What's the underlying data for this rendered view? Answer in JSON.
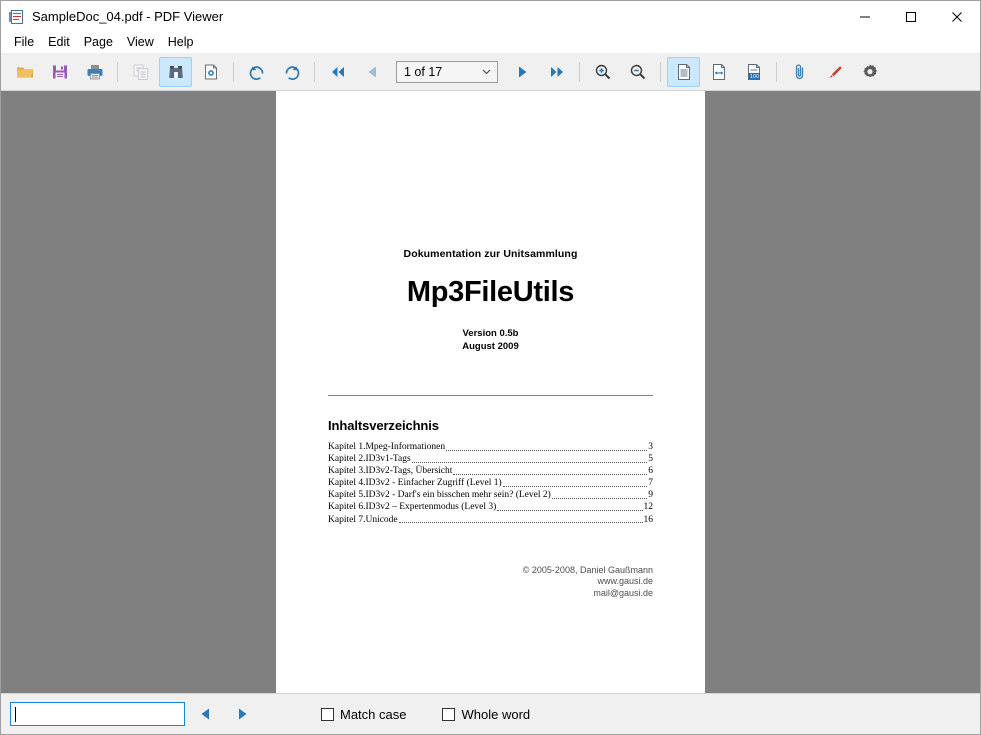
{
  "window": {
    "title": "SampleDoc_04.pdf - PDF Viewer",
    "app_icon": "pdf-document-icon",
    "controls": {
      "minimize": "minimize-icon",
      "maximize": "maximize-icon",
      "close": "close-icon"
    }
  },
  "menubar": {
    "items": [
      {
        "label": "File"
      },
      {
        "label": "Edit"
      },
      {
        "label": "Page"
      },
      {
        "label": "View"
      },
      {
        "label": "Help"
      }
    ]
  },
  "toolbar": {
    "buttons": [
      {
        "name": "open-file-button",
        "icon": "folder-open-icon",
        "state": "normal"
      },
      {
        "name": "save-button",
        "icon": "floppy-disk-icon",
        "state": "normal"
      },
      {
        "name": "print-button",
        "icon": "printer-icon",
        "state": "normal"
      },
      {
        "name": "copy-button",
        "icon": "copy-icon",
        "state": "disabled"
      },
      {
        "name": "find-button",
        "icon": "binoculars-icon",
        "state": "active"
      },
      {
        "name": "document-properties-button",
        "icon": "document-properties-icon",
        "state": "normal"
      },
      {
        "name": "rotate-left-button",
        "icon": "rotate-counterclockwise-icon",
        "state": "normal"
      },
      {
        "name": "rotate-right-button",
        "icon": "rotate-clockwise-icon",
        "state": "normal"
      },
      {
        "name": "first-page-button",
        "icon": "double-arrow-left-icon",
        "state": "normal"
      },
      {
        "name": "previous-page-button",
        "icon": "arrow-left-icon",
        "state": "dimmed"
      },
      {
        "name": "next-page-button",
        "icon": "arrow-right-icon",
        "state": "normal"
      },
      {
        "name": "last-page-button",
        "icon": "double-arrow-right-icon",
        "state": "normal"
      },
      {
        "name": "zoom-in-button",
        "icon": "magnifier-plus-icon",
        "state": "normal"
      },
      {
        "name": "zoom-out-button",
        "icon": "magnifier-minus-icon",
        "state": "normal"
      },
      {
        "name": "fit-page-button",
        "icon": "fit-page-icon",
        "state": "active"
      },
      {
        "name": "fit-width-button",
        "icon": "fit-width-icon",
        "state": "normal"
      },
      {
        "name": "zoom-100-button",
        "icon": "zoom-100-icon",
        "state": "normal"
      },
      {
        "name": "attachments-button",
        "icon": "paperclip-icon",
        "state": "normal"
      },
      {
        "name": "bookmark-button",
        "icon": "marker-pen-icon",
        "state": "normal"
      },
      {
        "name": "settings-button",
        "icon": "gear-icon",
        "state": "normal"
      }
    ],
    "page_selector": {
      "value": "1 of 17",
      "current_page": 1,
      "total_pages": 17,
      "chevron": "chevron-down-icon"
    },
    "zoom_100_badge": "100"
  },
  "document": {
    "subtitle": "Dokumentation zur Unitsammlung",
    "title": "Mp3FileUtils",
    "version": "Version 0.5b",
    "date": "August 2009",
    "toc_heading": "Inhaltsverzeichnis",
    "toc": [
      {
        "label": "Kapitel 1.Mpeg-Informationen",
        "page": "3"
      },
      {
        "label": "Kapitel 2.ID3v1-Tags",
        "page": "5"
      },
      {
        "label": "Kapitel 3.ID3v2-Tags, Übersicht",
        "page": "6"
      },
      {
        "label": "Kapitel 4.ID3v2 - Einfacher Zugriff (Level 1)",
        "page": "7"
      },
      {
        "label": "Kapitel 5.ID3v2 - Darf's ein bisschen mehr sein? (Level 2)",
        "page": "9"
      },
      {
        "label": "Kapitel 6.ID3v2 – Expertenmodus (Level 3)",
        "page": "12"
      },
      {
        "label": "Kapitel 7.Unicode",
        "page": "16"
      }
    ],
    "copyright": "© 2005-2008, Daniel Gaußmann",
    "website": "www.gausi.de",
    "email": "mail@gausi.de"
  },
  "findbar": {
    "search_value": "",
    "search_placeholder": "",
    "previous_match_icon": "arrow-left-icon",
    "next_match_icon": "arrow-right-icon",
    "match_case_label": "Match case",
    "match_case_checked": false,
    "whole_word_label": "Whole word",
    "whole_word_checked": false
  },
  "colors": {
    "viewport_background": "#808080",
    "chrome_background": "#f0f0f0",
    "accent_blue": "#1a6fb5",
    "active_highlight": "#cce8ff",
    "marker_red": "#c8422a"
  }
}
